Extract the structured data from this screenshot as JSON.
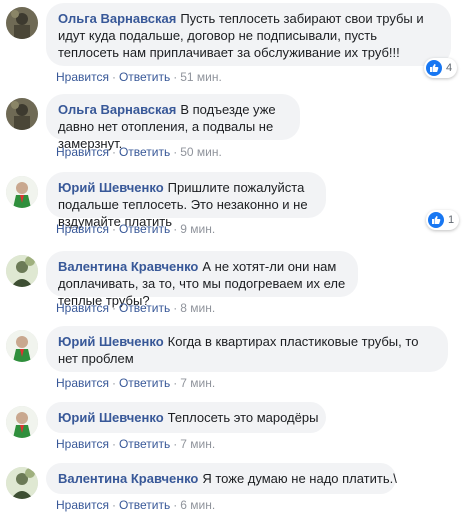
{
  "actions": {
    "like": "Нравится",
    "reply": "Ответить",
    "separator": "·"
  },
  "comments": [
    {
      "author": "Ольга Варнавская",
      "text": "Пусть теплосеть забирают свои трубы и идут куда подальше, договор не подписывали, пусть теплосеть нам приплачивает за обслуживание их труб!!!",
      "time": "51 мин.",
      "reactions": "4",
      "avatar": "avatar-olga"
    },
    {
      "author": "Ольга Варнавская",
      "text": "В подъезде уже давно нет отопления, а подвалы не замерзнут.",
      "time": "50 мин.",
      "avatar": "avatar-olga"
    },
    {
      "author": "Юрий Шевченко",
      "text": "Пришлите пожалуйста подальше теплосеть. Это незаконно и не вздумайте платить",
      "time": "9 мин.",
      "reactions": "1",
      "avatar": "avatar-yuri"
    },
    {
      "author": "Валентина Кравченко",
      "text": "А не хотят-ли они нам доплачивать, за то, что мы подогреваем их еле теплые трубы?",
      "time": "8 мин.",
      "avatar": "avatar-valentina"
    },
    {
      "author": "Юрий Шевченко",
      "text": "Когда в квартирах пластиковые трубы, то нет проблем",
      "time": "7 мин.",
      "avatar": "avatar-yuri"
    },
    {
      "author": "Юрий Шевченко",
      "text": "Теплосеть это мародёры",
      "time": "7 мин.",
      "avatar": "avatar-yuri"
    },
    {
      "author": "Валентина Кравченко",
      "text": "Я тоже думаю не надо платить.\\",
      "time": "6 мин.",
      "avatar": "avatar-valentina"
    }
  ],
  "colors": {
    "author": "#385898",
    "bubble": "#f2f3f5",
    "like_icon": "#1877f2"
  }
}
